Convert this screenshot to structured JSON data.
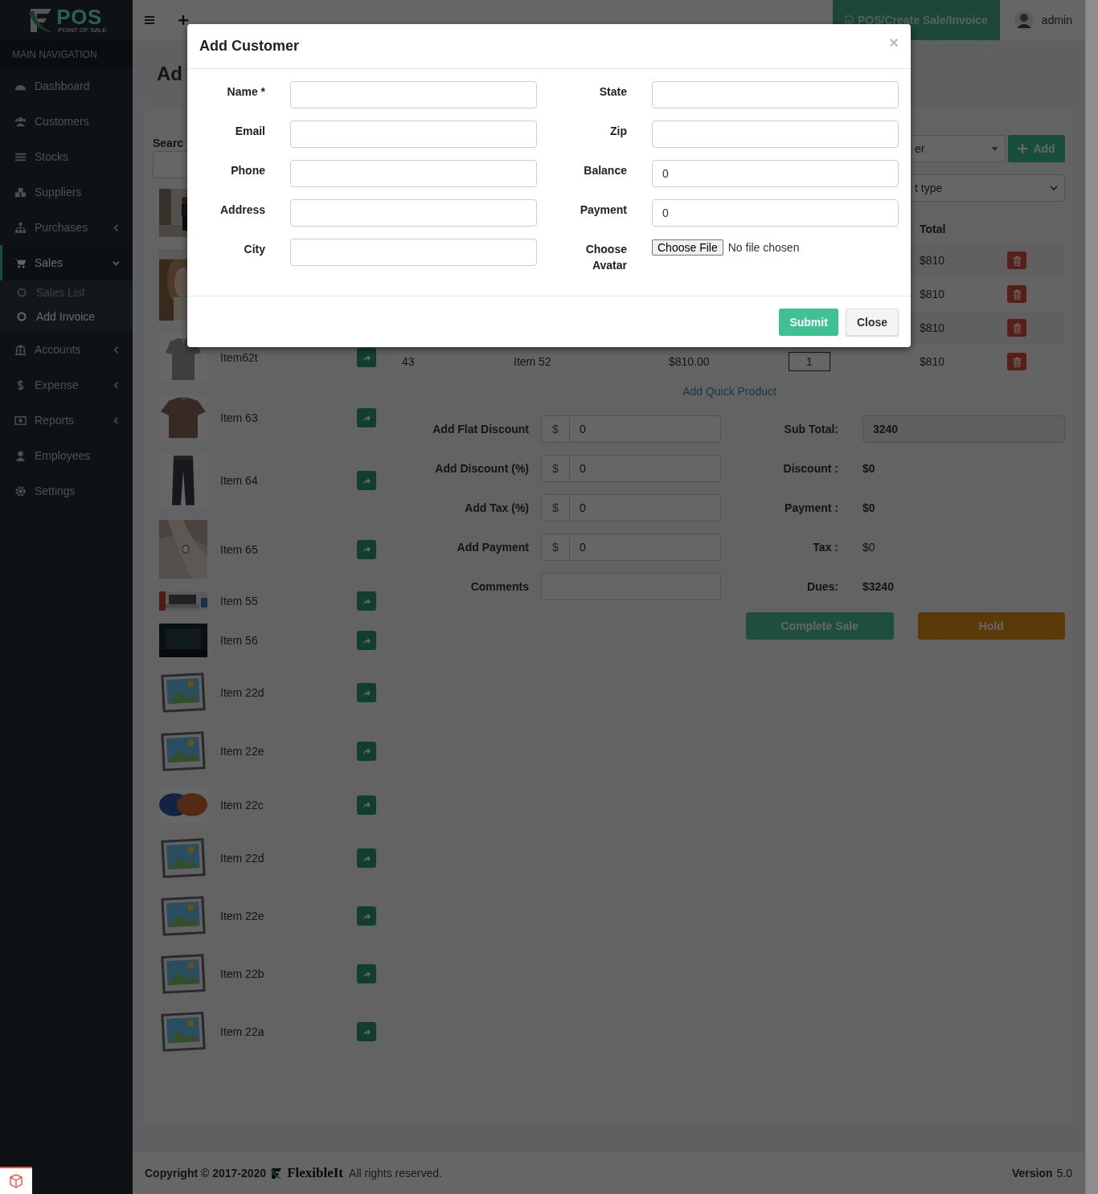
{
  "sidebar": {
    "logo": {
      "title": "POS",
      "subtitle": "POINT OF SALE"
    },
    "section_header": "MAIN NAVIGATION",
    "items": [
      {
        "label": "Dashboard",
        "kind": "link",
        "selected": false
      },
      {
        "label": "Customers",
        "kind": "link",
        "selected": false
      },
      {
        "label": "Stocks",
        "kind": "link",
        "selected": false
      },
      {
        "label": "Suppliers",
        "kind": "link",
        "selected": false
      },
      {
        "label": "Purchases",
        "kind": "submenu",
        "expanded": false,
        "selected": false
      },
      {
        "label": "Sales",
        "kind": "submenu",
        "expanded": true,
        "selected": true,
        "children": [
          {
            "label": "Sales List",
            "selected": false
          },
          {
            "label": "Add Invoice",
            "selected": true
          }
        ]
      },
      {
        "label": "Accounts",
        "kind": "submenu",
        "expanded": false,
        "selected": false
      },
      {
        "label": "Expense",
        "kind": "submenu",
        "expanded": false,
        "selected": false
      },
      {
        "label": "Reports",
        "kind": "submenu",
        "expanded": false,
        "selected": false
      },
      {
        "label": "Employees",
        "kind": "link",
        "selected": false
      },
      {
        "label": "Settings",
        "kind": "link",
        "selected": false
      }
    ]
  },
  "header": {
    "breadcrumb_tab": "POS/Create Sale/Invoice",
    "user": "admin"
  },
  "page": {
    "title": "Ad"
  },
  "products": {
    "search_label": "Searc",
    "items": [
      {
        "kind": "picture"
      },
      {
        "kind": "picture"
      },
      {
        "kind": "picture",
        "name": "Item62t"
      },
      {
        "kind": "picture",
        "name": "Item 63"
      },
      {
        "kind": "picture",
        "name": "Item 64"
      },
      {
        "kind": "picture",
        "name": "Item 65"
      },
      {
        "kind": "picture",
        "name": "Item 55"
      },
      {
        "kind": "picture",
        "name": "Item 56"
      },
      {
        "kind": "placeholder",
        "name": "Item 22d"
      },
      {
        "kind": "placeholder",
        "name": "Item 22e"
      },
      {
        "kind": "picture",
        "name": "Item 22c"
      },
      {
        "kind": "placeholder",
        "name": "Item 22d"
      },
      {
        "kind": "placeholder",
        "name": "Item 22e"
      },
      {
        "kind": "placeholder",
        "name": "Item 22b"
      },
      {
        "kind": "placeholder",
        "name": "Item 22a"
      }
    ]
  },
  "invoice": {
    "customer_select": "er",
    "add_button": "Add",
    "payment_type_select": "t type",
    "table": {
      "columns": [
        "Total"
      ],
      "rows": [
        {
          "total": "$810"
        },
        {
          "total": "$810"
        },
        {
          "total": "$810"
        },
        {
          "number": "43",
          "product": "Item 52",
          "price": "$810.00",
          "quantity": "1",
          "total": "$810"
        }
      ]
    },
    "add_quick_product": "Add Quick Product",
    "adjustments": [
      {
        "label": "Add Flat Discount",
        "prefix": "$",
        "value": "0"
      },
      {
        "label": "Add Discount (%)",
        "prefix": "$",
        "value": "0"
      },
      {
        "label": "Add Tax (%)",
        "prefix": "$",
        "value": "0"
      },
      {
        "label": "Add Payment",
        "prefix": "$",
        "value": "0"
      },
      {
        "label": "Comments"
      }
    ],
    "summary": [
      {
        "label": "Sub Total:",
        "value": "3240",
        "kind": "field"
      },
      {
        "label": "Discount :",
        "value": "$0",
        "kind": "bold"
      },
      {
        "label": "Payment :",
        "value": "$0",
        "kind": "bold"
      },
      {
        "label": "Tax :",
        "value": "$0",
        "kind": "plain"
      },
      {
        "label": "Dues:",
        "value": "$3240",
        "kind": "bold"
      }
    ],
    "actions": [
      {
        "label": "Complete Sale",
        "kind": "success"
      },
      {
        "label": "Hold",
        "kind": "warning"
      }
    ]
  },
  "modal": {
    "title": "Add Customer",
    "close_symbol": "×",
    "fields_left": [
      {
        "label": "Name *"
      },
      {
        "label": "Email"
      },
      {
        "label": "Phone"
      },
      {
        "label": "Address"
      },
      {
        "label": "City"
      }
    ],
    "fields_right": [
      {
        "label": "State",
        "kind": "text"
      },
      {
        "label": "Zip",
        "kind": "text"
      },
      {
        "label": "Balance",
        "kind": "text",
        "value": "0"
      },
      {
        "label": "Payment",
        "kind": "text",
        "value": "0"
      },
      {
        "label": "Choose Avatar",
        "kind": "file",
        "button": "Choose File",
        "status": "No file chosen"
      }
    ],
    "buttons": [
      {
        "label": "Submit",
        "kind": "primary"
      },
      {
        "label": "Close",
        "kind": "default"
      }
    ]
  },
  "footer": {
    "copyright": "Copyright © 2017-2020",
    "brand": "FlexibleIt",
    "rights": "All rights reserved.",
    "version_label": "Version",
    "version": "5.0"
  }
}
